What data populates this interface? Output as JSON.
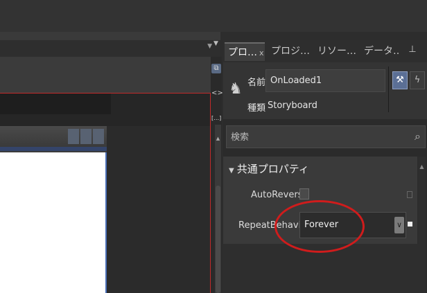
{
  "tabs": [
    {
      "label": "プロ…",
      "close": "x"
    },
    {
      "label": "プロジ…"
    },
    {
      "label": "リソー…"
    },
    {
      "label": "データ…"
    }
  ],
  "pin_icon": "pin-icon",
  "object": {
    "name_label": "名前",
    "name_value": "OnLoaded1",
    "type_label": "種類",
    "type_value": "Storyboard"
  },
  "search": {
    "placeholder": "検索",
    "icon": "search-icon"
  },
  "category": {
    "title": "共通プロパティ"
  },
  "properties": {
    "auto_reverse_label": "AutoReverse",
    "repeat_behavior_label": "RepeatBehavior",
    "repeat_behavior_value": "Forever"
  },
  "colors": {
    "highlight": "#d01c1c",
    "selected_tab": "#3f3f3f",
    "property_button": "#5b6f95"
  }
}
